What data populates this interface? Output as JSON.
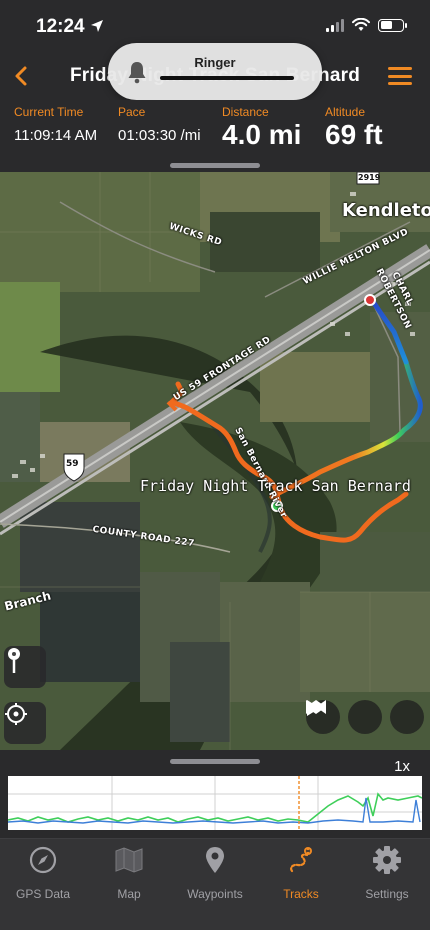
{
  "status": {
    "time": "12:24"
  },
  "ringer": {
    "label": "Ringer"
  },
  "header": {
    "title": "Friday Night Track San Bernard"
  },
  "stats": [
    {
      "label": "Current Time",
      "value": "11:09:14 AM"
    },
    {
      "label": "Pace",
      "value": "01:03:30 /mi"
    },
    {
      "label": "Distance",
      "value": "4.0 mi"
    },
    {
      "label": "Altitude",
      "value": "69 ft"
    }
  ],
  "map": {
    "place": "Kendleton",
    "track_label": "Friday Night Track San Bernard",
    "roads": {
      "wicks": "WICKS RD",
      "willie": "WILLIE MELTON BLVD",
      "robertson": "ROBERTSON",
      "charlie": "CHARL",
      "frontage": "US 59 FRONTAGE RD",
      "county": "COUNTY ROAD 227",
      "san_bernard": "San Bernard River",
      "branch": "Branch",
      "hwy": "59",
      "fm": "2919"
    }
  },
  "elevation": {
    "speed": "1x"
  },
  "tabs": [
    {
      "label": "GPS Data",
      "icon": "compass-icon"
    },
    {
      "label": "Map",
      "icon": "map-icon"
    },
    {
      "label": "Waypoints",
      "icon": "pin-icon"
    },
    {
      "label": "Tracks",
      "icon": "tracks-icon",
      "active": true
    },
    {
      "label": "Settings",
      "icon": "gear-icon"
    }
  ],
  "colors": {
    "accent": "#f08a24",
    "track_start": "#f06a1e",
    "track_end": "#1f5ecf"
  }
}
